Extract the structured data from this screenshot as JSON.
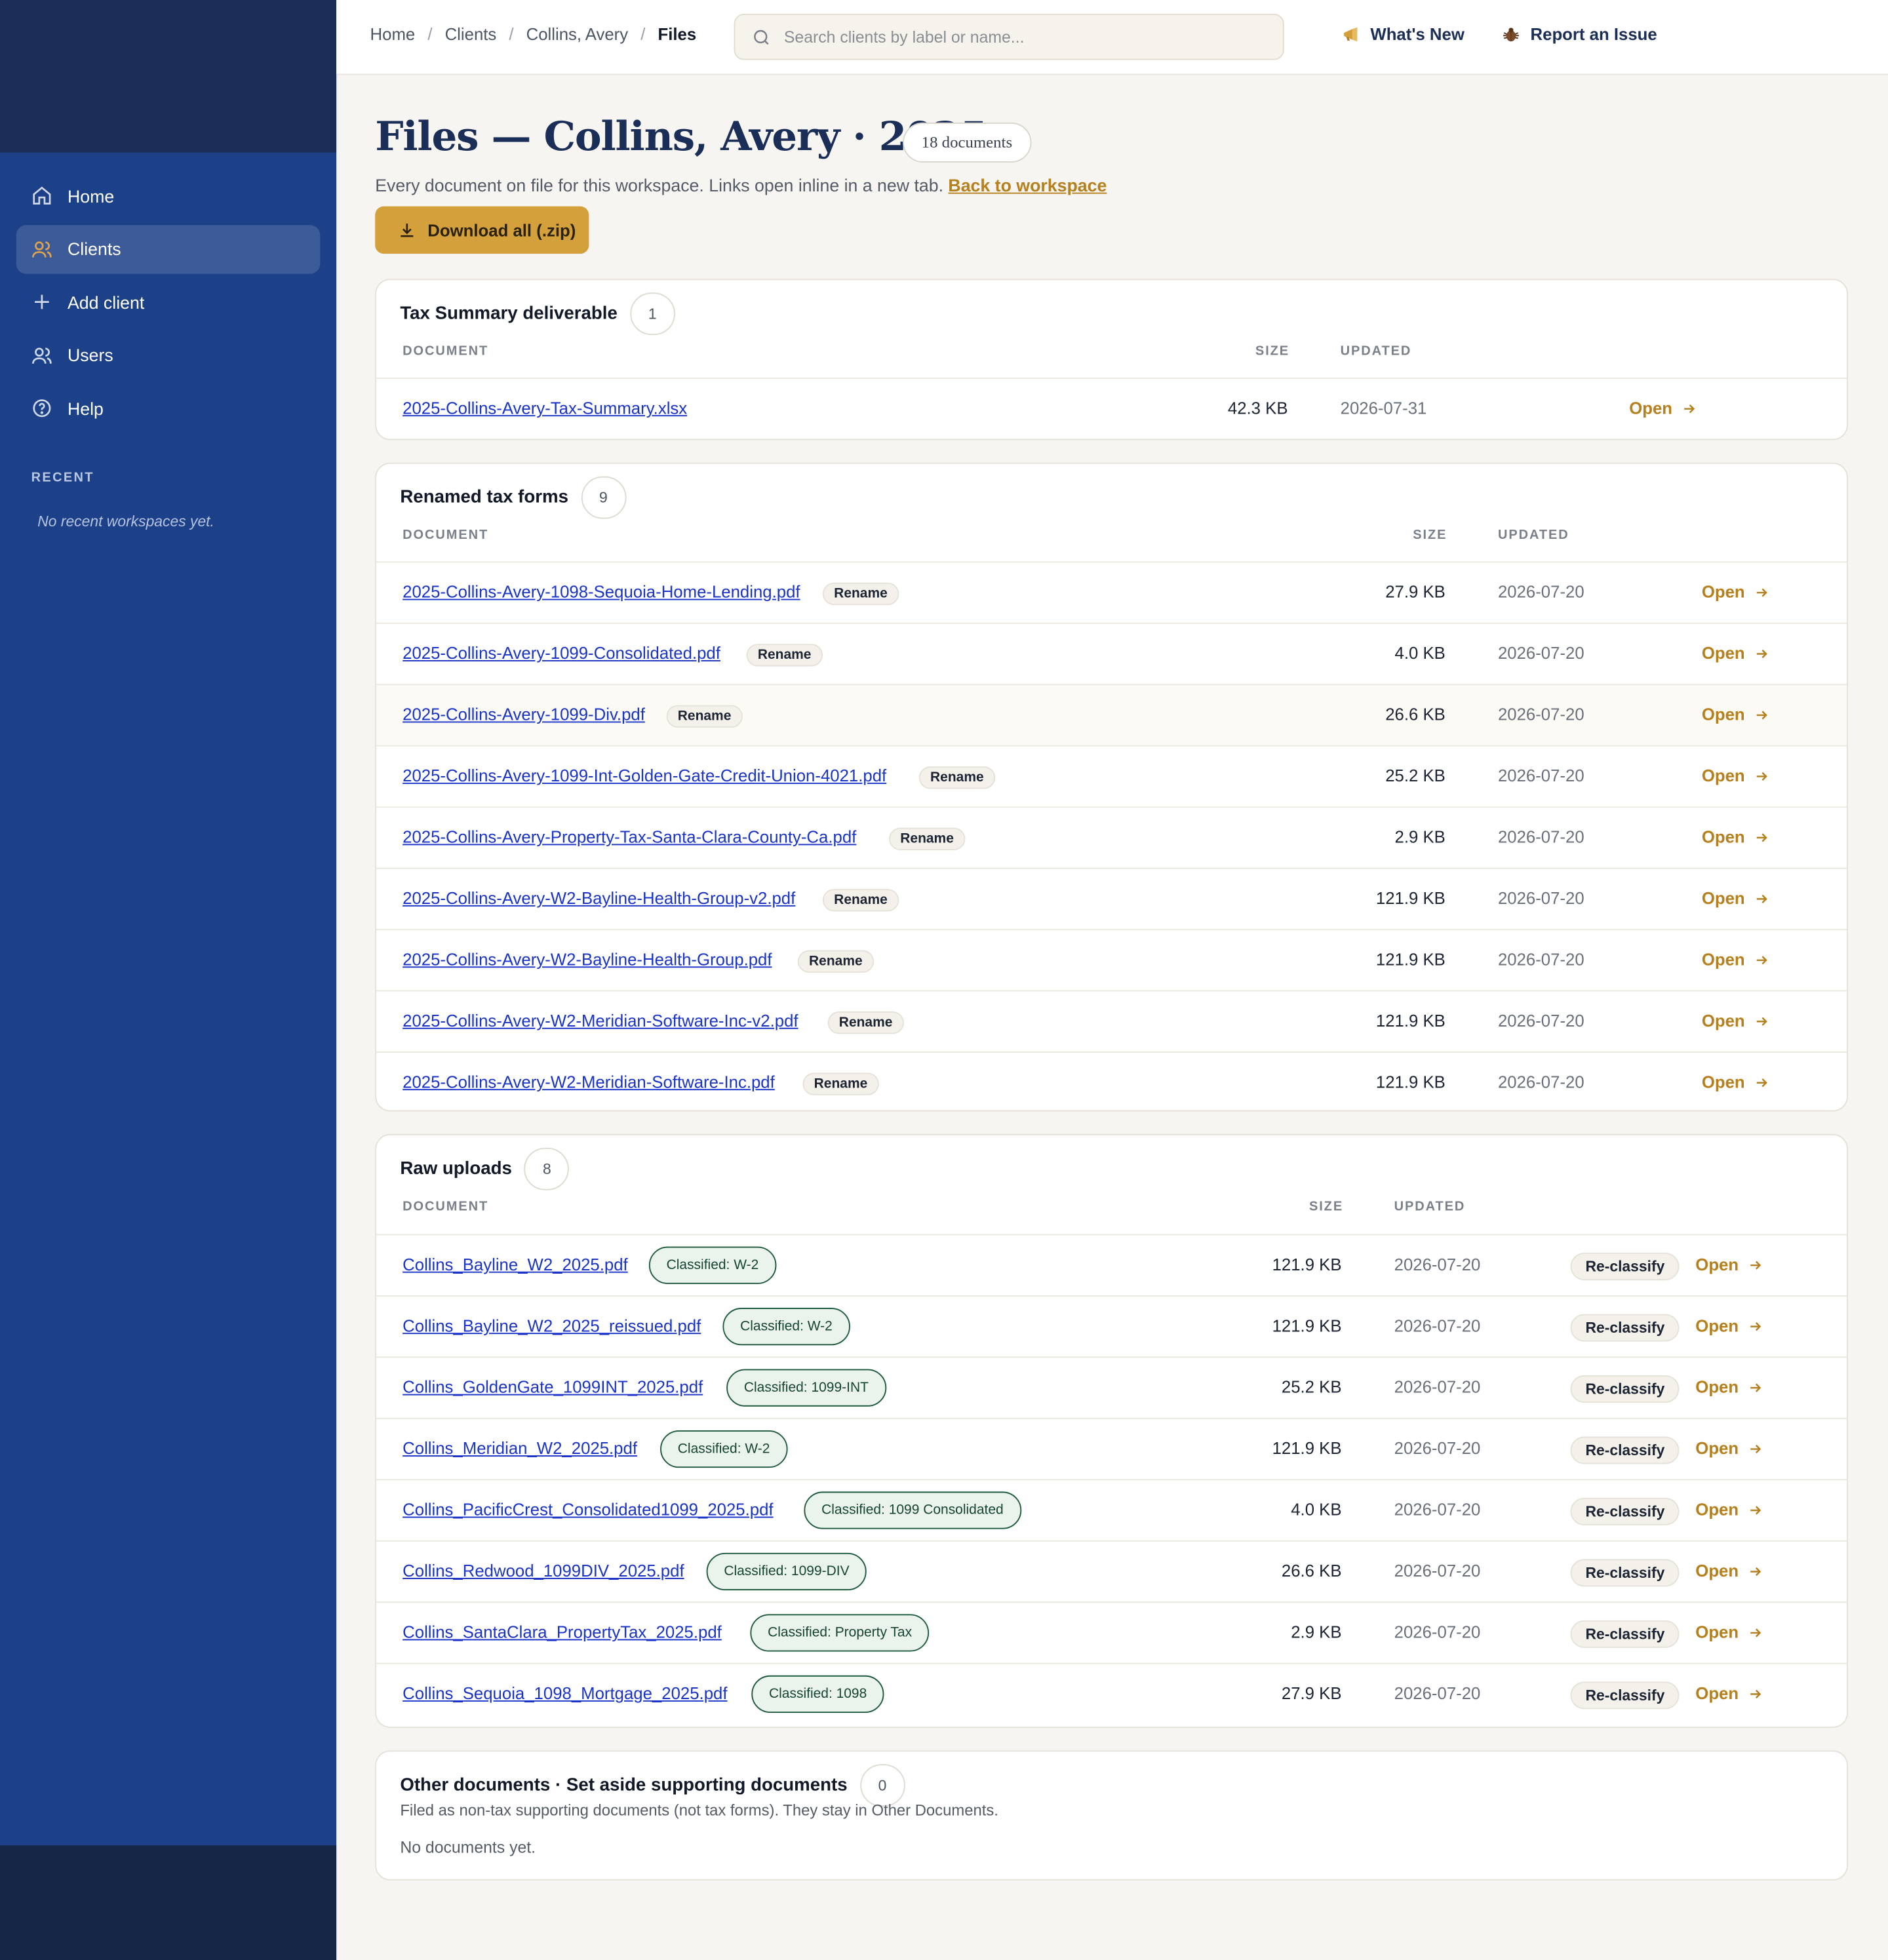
{
  "nav": {
    "items": [
      {
        "label": "Home",
        "icon": "home-icon"
      },
      {
        "label": "Clients",
        "icon": "clients-icon",
        "active": true
      },
      {
        "label": "Add client",
        "icon": "plus-icon"
      },
      {
        "label": "Users",
        "icon": "users-icon"
      },
      {
        "label": "Help",
        "icon": "help-icon"
      }
    ],
    "recent_title": "RECENT",
    "recent_empty": "No recent workspaces yet."
  },
  "topbar": {
    "breadcrumbs": [
      "Home",
      "Clients",
      "Collins, Avery",
      "Files"
    ],
    "search_placeholder": "Search clients by label or name...",
    "whats_new": "What's New",
    "report_issue": "Report an Issue"
  },
  "header": {
    "title": "Files — Collins, Avery · 2025",
    "doc_count": "18 documents",
    "subtitle": "Every document on file for this workspace. Links open inline in a new tab.",
    "back_link": "Back to workspace",
    "download_label": "Download all (.zip)"
  },
  "columns": {
    "document": "DOCUMENT",
    "size": "SIZE",
    "updated": "UPDATED"
  },
  "labels": {
    "open": "Open",
    "rename": "Rename",
    "reclassify": "Re-classify"
  },
  "deliverable": {
    "title": "Tax Summary deliverable",
    "count": "1",
    "rows": [
      {
        "name": "2025-Collins-Avery-Tax-Summary.xlsx",
        "size": "42.3 KB",
        "updated": "2026-07-31"
      }
    ]
  },
  "renamed": {
    "title": "Renamed tax forms",
    "count": "9",
    "rows": [
      {
        "name": "2025-Collins-Avery-1098-Sequoia-Home-Lending.pdf",
        "size": "27.9 KB",
        "updated": "2026-07-20"
      },
      {
        "name": "2025-Collins-Avery-1099-Consolidated.pdf",
        "size": "4.0 KB",
        "updated": "2026-07-20"
      },
      {
        "name": "2025-Collins-Avery-1099-Div.pdf",
        "size": "26.6 KB",
        "updated": "2026-07-20"
      },
      {
        "name": "2025-Collins-Avery-1099-Int-Golden-Gate-Credit-Union-4021.pdf",
        "size": "25.2 KB",
        "updated": "2026-07-20"
      },
      {
        "name": "2025-Collins-Avery-Property-Tax-Santa-Clara-County-Ca.pdf",
        "size": "2.9 KB",
        "updated": "2026-07-20"
      },
      {
        "name": "2025-Collins-Avery-W2-Bayline-Health-Group-v2.pdf",
        "size": "121.9 KB",
        "updated": "2026-07-20"
      },
      {
        "name": "2025-Collins-Avery-W2-Bayline-Health-Group.pdf",
        "size": "121.9 KB",
        "updated": "2026-07-20"
      },
      {
        "name": "2025-Collins-Avery-W2-Meridian-Software-Inc-v2.pdf",
        "size": "121.9 KB",
        "updated": "2026-07-20"
      },
      {
        "name": "2025-Collins-Avery-W2-Meridian-Software-Inc.pdf",
        "size": "121.9 KB",
        "updated": "2026-07-20"
      }
    ]
  },
  "raw": {
    "title": "Raw uploads",
    "count": "8",
    "rows": [
      {
        "name": "Collins_Bayline_W2_2025.pdf",
        "class": "Classified: W-2",
        "size": "121.9 KB",
        "updated": "2026-07-20"
      },
      {
        "name": "Collins_Bayline_W2_2025_reissued.pdf",
        "class": "Classified: W-2",
        "size": "121.9 KB",
        "updated": "2026-07-20"
      },
      {
        "name": "Collins_GoldenGate_1099INT_2025.pdf",
        "class": "Classified: 1099-INT",
        "size": "25.2 KB",
        "updated": "2026-07-20"
      },
      {
        "name": "Collins_Meridian_W2_2025.pdf",
        "class": "Classified: W-2",
        "size": "121.9 KB",
        "updated": "2026-07-20"
      },
      {
        "name": "Collins_PacificCrest_Consolidated1099_2025.pdf",
        "class": "Classified: 1099 Consolidated",
        "size": "4.0 KB",
        "updated": "2026-07-20"
      },
      {
        "name": "Collins_Redwood_1099DIV_2025.pdf",
        "class": "Classified: 1099-DIV",
        "size": "26.6 KB",
        "updated": "2026-07-20"
      },
      {
        "name": "Collins_SantaClara_PropertyTax_2025.pdf",
        "class": "Classified: Property Tax",
        "size": "2.9 KB",
        "updated": "2026-07-20"
      },
      {
        "name": "Collins_Sequoia_1098_Mortgage_2025.pdf",
        "class": "Classified: 1098",
        "size": "27.9 KB",
        "updated": "2026-07-20"
      }
    ]
  },
  "other": {
    "title": "Other documents · Set aside supporting documents",
    "count": "0",
    "description": "Filed as non-tax supporting documents (not tax forms). They stay in Other Documents.",
    "empty": "No documents yet."
  },
  "colors": {
    "accent": "#d4a03c",
    "link": "#1a33c8",
    "navy": "#1b2e57",
    "sidebar": "#1d4188"
  }
}
